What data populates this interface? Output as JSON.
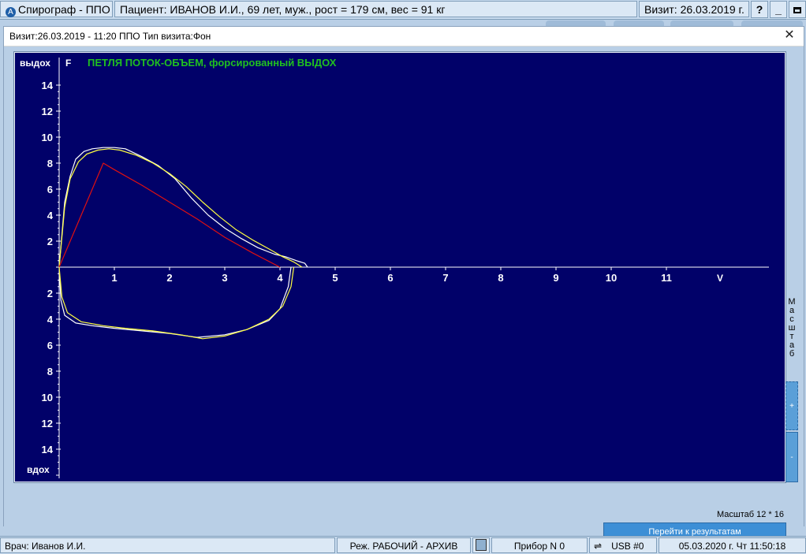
{
  "window": {
    "app_title": "Спирограф - ППО",
    "patient": "Пациент:  ИВАНОВ И.И., 69 лет, муж., рост = 179 см, вес = 91 кг",
    "visit": "Визит:  26.03.2019 г.",
    "help_label": "?",
    "minimize_label": "_",
    "maximize_label": ""
  },
  "dialog": {
    "title": "Визит:26.03.2019 - 11:20 ППО Тип визита:Фон",
    "close_label": "✕",
    "scale_text": "Масштаб 12 * 16",
    "goto_button": "Перейти к результатам",
    "side_label": "Масштаб",
    "zoom_in": "+",
    "zoom_out": "-"
  },
  "status": {
    "doctor": "Врач: Иванов И.И.",
    "mode": "Реж. РАБОЧИЙ - АРХИВ",
    "device": "Прибор N 0",
    "usb": "USB #0",
    "datetime": "05.03.2020 г.  Чт  11:50:18"
  },
  "colors": {
    "plot_bg": "#010169",
    "axis": "#ffffff",
    "title_green": "#20c020",
    "curve_white": "#ffffff",
    "curve_yellow": "#ffff40",
    "predicted_red": "#e01010"
  },
  "icons": {
    "app": "spirograph-logo-icon",
    "calculator": "calculator-icon",
    "usb": "usb-icon",
    "close": "close-icon"
  },
  "chart_data": {
    "type": "line",
    "title": "ПЕТЛЯ ПОТОК-ОБЪЕМ, форсированный ВЫДОХ",
    "ylabel_letter": "F",
    "xlabel": "V",
    "ylabel_top": "выдох",
    "ylabel_bottom": "вдох",
    "xlim": [
      0,
      12.9
    ],
    "ylim": [
      -16,
      14
    ],
    "x_ticks": [
      1,
      2,
      3,
      4,
      5,
      6,
      7,
      8,
      9,
      10,
      11
    ],
    "y_ticks_up": [
      2,
      4,
      6,
      8,
      10,
      12,
      14
    ],
    "y_ticks_down": [
      2,
      4,
      6,
      8,
      10,
      12,
      14
    ],
    "series": [
      {
        "color": "white",
        "x": [
          0.0,
          0.05,
          0.1,
          0.2,
          0.3,
          0.45,
          0.6,
          0.8,
          1.0,
          1.2,
          1.5,
          1.8,
          2.1,
          2.4,
          2.7,
          3.0,
          3.3,
          3.6,
          3.9,
          4.1,
          4.3,
          4.45,
          4.5
        ],
        "y": [
          0.0,
          2.5,
          5.0,
          7.0,
          8.3,
          8.9,
          9.1,
          9.2,
          9.2,
          9.1,
          8.5,
          7.8,
          6.8,
          5.3,
          4.0,
          3.0,
          2.2,
          1.5,
          1.0,
          0.8,
          0.5,
          0.3,
          0.0
        ]
      },
      {
        "color": "yellow",
        "x": [
          0.0,
          0.05,
          0.1,
          0.2,
          0.35,
          0.5,
          0.7,
          0.9,
          1.1,
          1.4,
          1.7,
          2.0,
          2.3,
          2.6,
          2.9,
          3.2,
          3.5,
          3.8,
          4.05,
          4.25,
          4.4
        ],
        "y": [
          0.0,
          2.3,
          4.6,
          6.8,
          8.1,
          8.7,
          9.0,
          9.1,
          9.0,
          8.6,
          8.0,
          7.2,
          6.2,
          5.0,
          3.9,
          2.9,
          2.1,
          1.4,
          0.8,
          0.4,
          0.0
        ]
      },
      {
        "color": "white",
        "x": [
          0.0,
          0.03,
          0.1,
          0.3,
          0.6,
          1.0,
          1.5,
          2.0,
          2.5,
          3.0,
          3.4,
          3.8,
          4.0,
          4.15,
          4.2
        ],
        "y": [
          0.0,
          -2.5,
          -3.7,
          -4.3,
          -4.5,
          -4.7,
          -4.9,
          -5.1,
          -5.4,
          -5.2,
          -4.8,
          -4.1,
          -3.2,
          -1.5,
          0.0
        ]
      },
      {
        "color": "yellow",
        "x": [
          0.0,
          0.05,
          0.15,
          0.4,
          0.8,
          1.2,
          1.7,
          2.2,
          2.6,
          3.0,
          3.4,
          3.8,
          4.05,
          4.2,
          4.25
        ],
        "y": [
          0.0,
          -2.3,
          -3.5,
          -4.2,
          -4.5,
          -4.7,
          -4.9,
          -5.2,
          -5.5,
          -5.3,
          -4.8,
          -4.0,
          -3.0,
          -1.5,
          0.0
        ]
      },
      {
        "color": "red",
        "x": [
          0.0,
          0.8,
          1.0,
          1.5,
          2.0,
          2.5,
          3.0,
          3.5,
          4.0
        ],
        "y": [
          0.0,
          8.0,
          7.5,
          6.3,
          5.0,
          3.7,
          2.3,
          1.1,
          0.0
        ]
      }
    ]
  }
}
